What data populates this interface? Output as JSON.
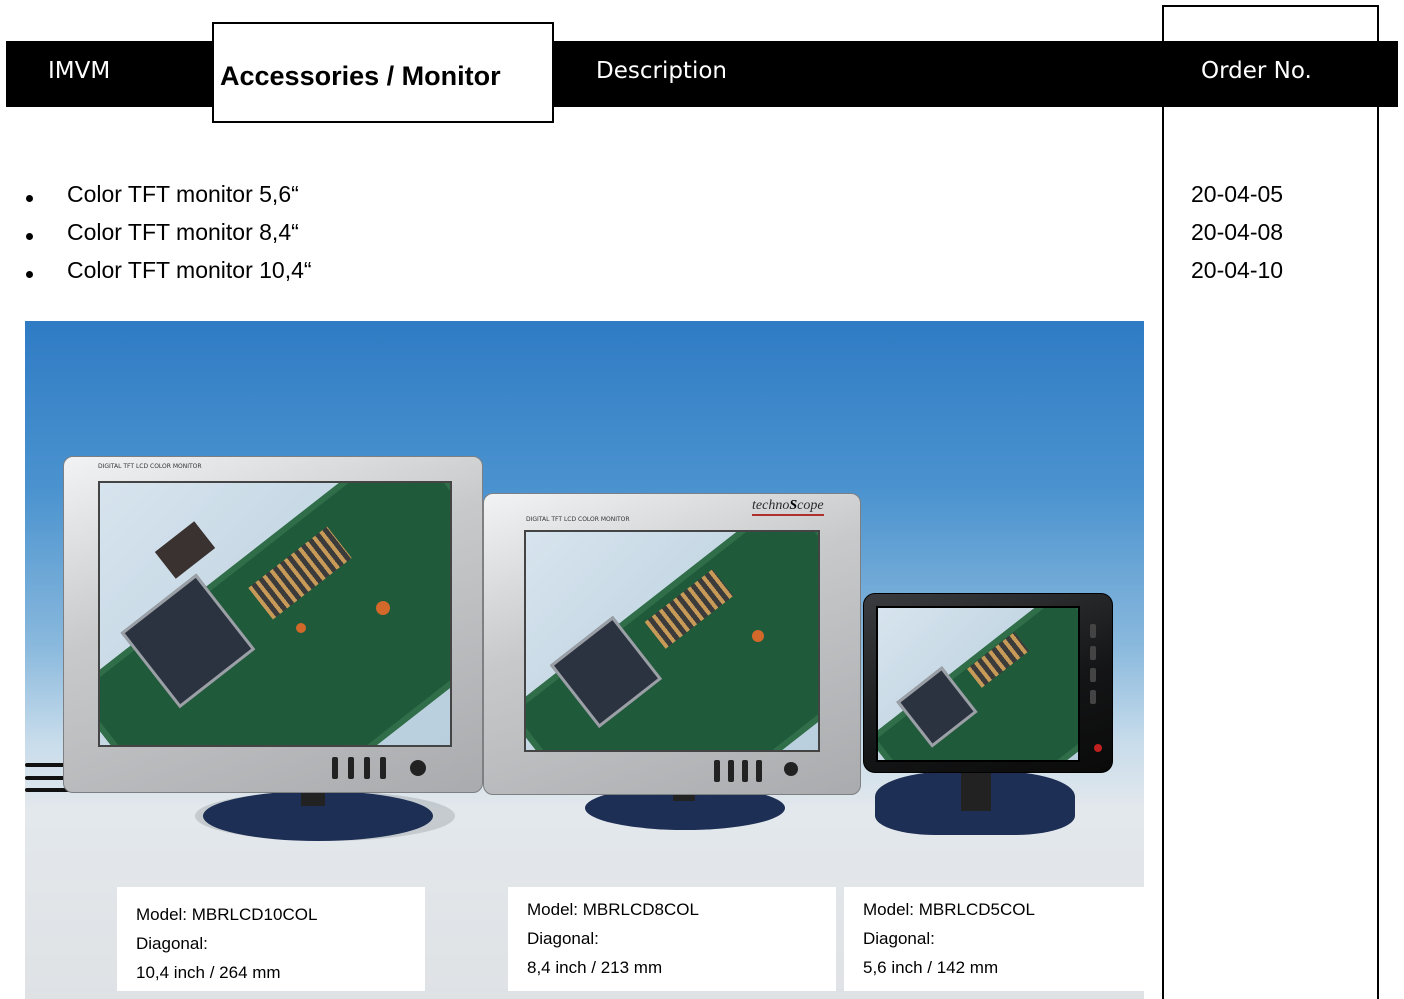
{
  "header": {
    "left": "IMVM",
    "title": "Accessories / Monitor",
    "description": "Description",
    "order_no": "Order No."
  },
  "items": [
    {
      "label": "Color TFT monitor   5,6“",
      "order_no": "20-04-05"
    },
    {
      "label": "Color TFT monitor   8,4“",
      "order_no": "20-04-08"
    },
    {
      "label": "Color TFT monitor 10,4“",
      "order_no": "20-04-10"
    }
  ],
  "photo": {
    "brand_logo": "technoScope",
    "brand_logo_parts": [
      "techno",
      "S",
      "cope"
    ],
    "monitor_caption": "DIGITAL TFT LCD COLOR MONITOR",
    "captions": [
      {
        "model": "Model: MBRLCD10COL",
        "diagonal_label": "Diagonal:",
        "diagonal": "10,4 inch / 264 mm"
      },
      {
        "model": "Model: MBRLCD8COL",
        "diagonal_label": "Diagonal:",
        "diagonal": "8,4 inch / 213 mm"
      },
      {
        "model": "Model: MBRLCD5COL",
        "diagonal_label": "Diagonal:",
        "diagonal": "5,6 inch / 142 mm"
      }
    ]
  },
  "colors": {
    "header_bar": "#000000",
    "header_text": "#ffffff",
    "stand": "#1e2f55",
    "logo_underline": "#b03030"
  }
}
